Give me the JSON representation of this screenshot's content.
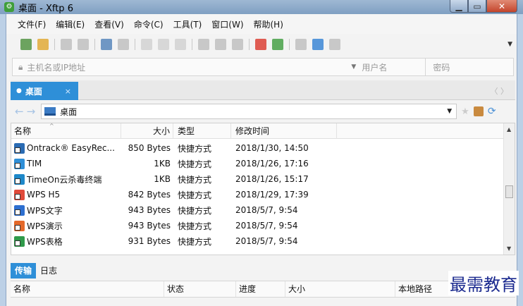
{
  "window": {
    "title": "桌面 - Xftp 6",
    "minimize": "▁",
    "maximize": "▭",
    "close": "✕"
  },
  "menu": [
    "文件(F)",
    "编辑(E)",
    "查看(V)",
    "命令(C)",
    "工具(T)",
    "窗口(W)",
    "帮助(H)"
  ],
  "toolbar": {
    "icons": [
      {
        "name": "new-session-icon",
        "color": "#4a8f3a"
      },
      {
        "name": "open-folder-icon",
        "color": "#e0a52a"
      },
      {
        "name": "connect-icon",
        "color": "#bdbdbd"
      },
      {
        "name": "disconnect-icon",
        "color": "#bdbdbd"
      },
      {
        "name": "properties-icon",
        "color": "#4d7fb8"
      },
      {
        "name": "view-icon",
        "color": "#bdbdbd"
      },
      {
        "name": "copy-icon",
        "color": "#cfcfcf"
      },
      {
        "name": "paste-icon",
        "color": "#cfcfcf"
      },
      {
        "name": "compare-icon",
        "color": "#cfcfcf"
      },
      {
        "name": "transfer-up-icon",
        "color": "#bdbdbd"
      },
      {
        "name": "transfer-down-icon",
        "color": "#bdbdbd"
      },
      {
        "name": "stop-icon",
        "color": "#bdbdbd"
      },
      {
        "name": "xshell-icon",
        "color": "#d9362b"
      },
      {
        "name": "xftp-icon",
        "color": "#3c9b3c"
      },
      {
        "name": "settings-icon",
        "color": "#bdbdbd"
      },
      {
        "name": "help-icon",
        "color": "#2f7fd3"
      },
      {
        "name": "comment-icon",
        "color": "#bdbdbd"
      }
    ]
  },
  "address": {
    "host_placeholder": "主机名或IP地址",
    "user_placeholder": "用户名",
    "password_placeholder": "密码"
  },
  "tab": {
    "label": "桌面",
    "close": "×",
    "nav": "〈  〉"
  },
  "path": {
    "back": "←",
    "forward": "→",
    "value": "桌面"
  },
  "filelist": {
    "columns": {
      "name": "名称",
      "size": "大小",
      "type": "类型",
      "modified": "修改时间"
    },
    "rows": [
      {
        "name": "Ontrack® EasyRec...",
        "size": "850 Bytes",
        "type": "快捷方式",
        "modified": "2018/1/30, 14:50",
        "icon_color": "#2a6bb3"
      },
      {
        "name": "TIM",
        "size": "1KB",
        "type": "快捷方式",
        "modified": "2018/1/26, 17:16",
        "icon_color": "#2e8fd8"
      },
      {
        "name": "TimeOn云杀毒终端",
        "size": "1KB",
        "type": "快捷方式",
        "modified": "2018/1/26, 15:17",
        "icon_color": "#1e88c9"
      },
      {
        "name": "WPS H5",
        "size": "842 Bytes",
        "type": "快捷方式",
        "modified": "2018/1/29, 17:39",
        "icon_color": "#e04a3a"
      },
      {
        "name": "WPS文字",
        "size": "943 Bytes",
        "type": "快捷方式",
        "modified": "2018/5/7, 9:54",
        "icon_color": "#2d6fd0"
      },
      {
        "name": "WPS演示",
        "size": "943 Bytes",
        "type": "快捷方式",
        "modified": "2018/5/7, 9:54",
        "icon_color": "#e4692a"
      },
      {
        "name": "WPS表格",
        "size": "931 Bytes",
        "type": "快捷方式",
        "modified": "2018/5/7, 9:54",
        "icon_color": "#2f9a4a"
      }
    ]
  },
  "bottom": {
    "tab_transfer": "传输",
    "tab_log": "日志",
    "columns": {
      "name": "名称",
      "status": "状态",
      "progress": "进度",
      "size": "大小",
      "local_path": "本地路径"
    }
  },
  "watermark": "最需教育"
}
